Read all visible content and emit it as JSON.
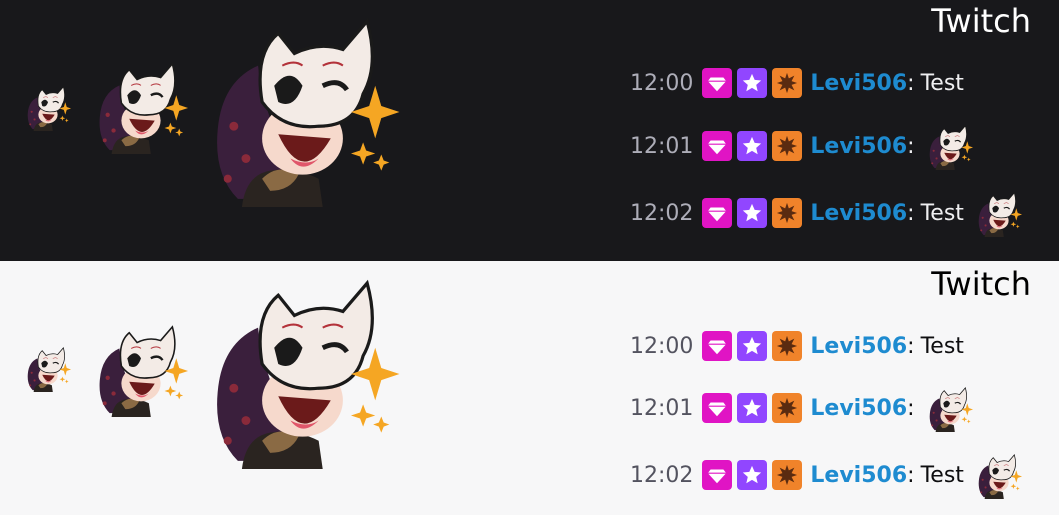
{
  "theme_colors": {
    "dark_bg": "#18181b",
    "light_bg": "#f7f7f8",
    "username": "#1e8bd0",
    "badge_sub": "#e014c4",
    "badge_prime": "#9146ff",
    "badge_bits": "#f0832a"
  },
  "panels": [
    {
      "theme": "dark",
      "platform_label": "Twitch",
      "emotes": [
        "cat-mask-emote",
        "cat-mask-emote",
        "cat-mask-emote"
      ],
      "messages": [
        {
          "time": "12:00",
          "badges": [
            "diamond-icon",
            "star-icon",
            "starburst-icon"
          ],
          "user": "Levi506",
          "colon": ":",
          "text": "Test",
          "emote": ""
        },
        {
          "time": "12:01",
          "badges": [
            "diamond-icon",
            "star-icon",
            "starburst-icon"
          ],
          "user": "Levi506",
          "colon": ":",
          "text": "",
          "emote": "cat-mask-emote"
        },
        {
          "time": "12:02",
          "badges": [
            "diamond-icon",
            "star-icon",
            "starburst-icon"
          ],
          "user": "Levi506",
          "colon": ":",
          "text": "Test",
          "emote": "cat-mask-emote"
        }
      ]
    },
    {
      "theme": "light",
      "platform_label": "Twitch",
      "emotes": [
        "cat-mask-emote",
        "cat-mask-emote",
        "cat-mask-emote"
      ],
      "messages": [
        {
          "time": "12:00",
          "badges": [
            "diamond-icon",
            "star-icon",
            "starburst-icon"
          ],
          "user": "Levi506",
          "colon": ":",
          "text": "Test",
          "emote": ""
        },
        {
          "time": "12:01",
          "badges": [
            "diamond-icon",
            "star-icon",
            "starburst-icon"
          ],
          "user": "Levi506",
          "colon": ":",
          "text": "",
          "emote": "cat-mask-emote"
        },
        {
          "time": "12:02",
          "badges": [
            "diamond-icon",
            "star-icon",
            "starburst-icon"
          ],
          "user": "Levi506",
          "colon": ":",
          "text": "Test",
          "emote": "cat-mask-emote"
        }
      ]
    }
  ]
}
